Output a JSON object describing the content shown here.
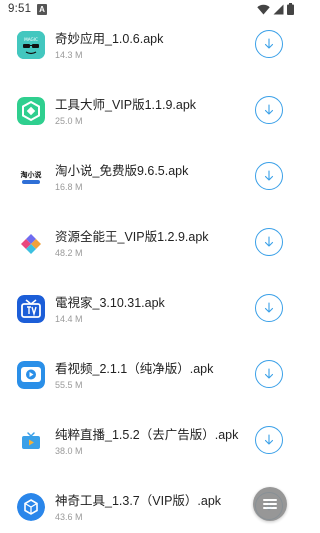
{
  "status_bar": {
    "time": "9:51",
    "notification_icon": "A",
    "icons": [
      "wifi-icon",
      "signal-icon",
      "battery-icon"
    ]
  },
  "colors": {
    "accent": "#3aa0e8",
    "text_primary": "#222222",
    "text_secondary": "#9a9a9a",
    "fab": "#8f8f8f"
  },
  "files": [
    {
      "name": "奇妙应用_1.0.6.apk",
      "size": "14.3 M",
      "icon": "magic-app-icon",
      "icon_text": "MAGIC"
    },
    {
      "name": "工具大师_VIP版1.1.9.apk",
      "size": "25.0 M",
      "icon": "tool-master-icon"
    },
    {
      "name": "淘小说_免费版9.6.5.apk",
      "size": "16.8 M",
      "icon": "tao-novel-icon",
      "icon_text": "淘小说"
    },
    {
      "name": "资源全能王_VIP版1.2.9.apk",
      "size": "48.2 M",
      "icon": "resource-king-icon"
    },
    {
      "name": "電視家_3.10.31.apk",
      "size": "14.4 M",
      "icon": "tv-home-icon"
    },
    {
      "name": "看视频_2.1.1（纯净版）.apk",
      "size": "55.5 M",
      "icon": "video-play-icon"
    },
    {
      "name": "纯粹直播_1.5.2（去广告版）.apk",
      "size": "38.0 M",
      "icon": "pure-live-icon"
    },
    {
      "name": "神奇工具_1.3.7（VIP版）.apk",
      "size": "43.6 M",
      "icon": "magic-tool-icon"
    }
  ],
  "download_icon": "download-arrow-icon",
  "fab_icon": "menu-lines-icon"
}
